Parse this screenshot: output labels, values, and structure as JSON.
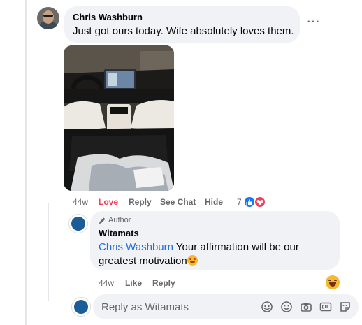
{
  "comment": {
    "author": "Chris Washburn",
    "text": "Just got ours today. Wife absolutely loves them.",
    "more_label": "···",
    "time": "44w",
    "actions": {
      "love": "Love",
      "reply": "Reply",
      "see_chat": "See Chat",
      "hide": "Hide"
    },
    "reaction_count": "7"
  },
  "reply": {
    "author_tag": "Author",
    "author": "Witamats",
    "mention": "Chris Washburn",
    "text": "Your affirmation will be our greatest motivation",
    "time": "44w",
    "actions": {
      "like": "Like",
      "reply": "Reply"
    }
  },
  "composer": {
    "placeholder": "Reply as Witamats"
  },
  "colors": {
    "love": "#f33e58",
    "mention": "#216fdb",
    "bubble": "#f0f2f5",
    "secondary_text": "#65676b"
  },
  "icons": [
    "pen-icon",
    "like-reaction-icon",
    "love-reaction-icon",
    "laugh-emoji-icon",
    "avatar-icon",
    "emoji-icon",
    "camera-icon",
    "gif-icon",
    "sticker-icon"
  ]
}
